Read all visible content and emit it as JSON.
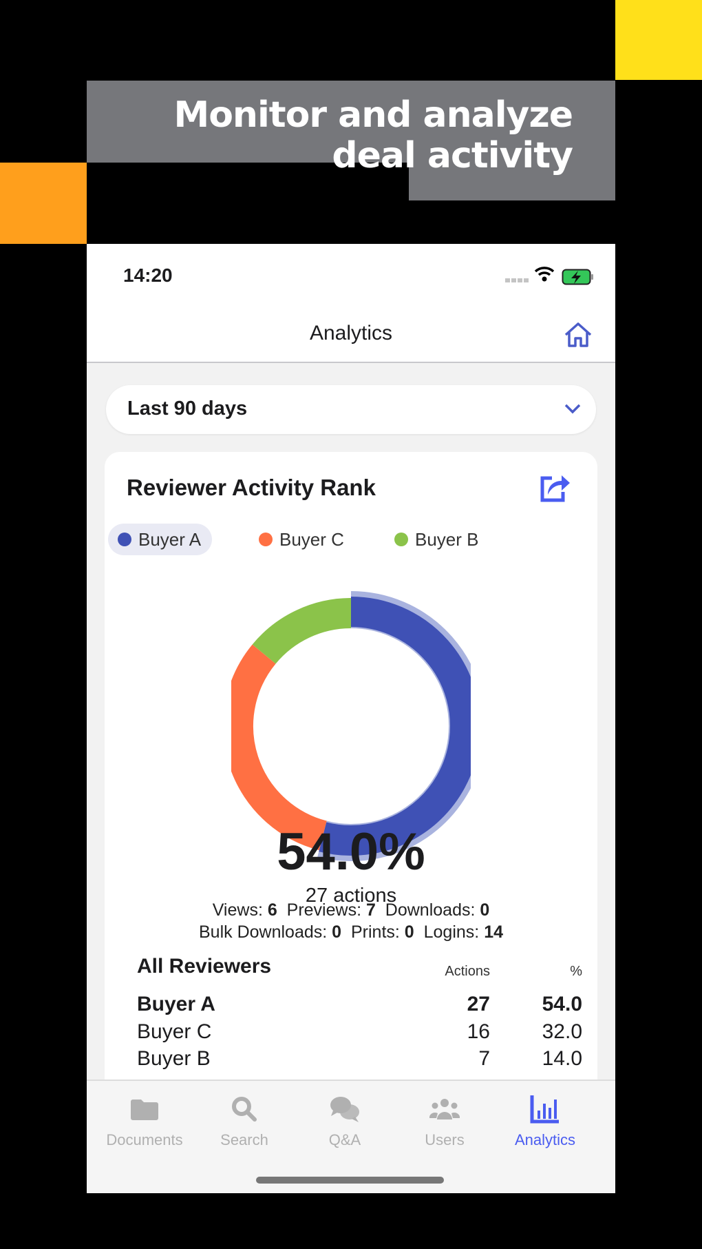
{
  "banner": {
    "headline": "Monitor and analyze deal activity"
  },
  "status_bar": {
    "time": "14:20"
  },
  "nav": {
    "title": "Analytics",
    "home_icon": "home-icon"
  },
  "filter": {
    "selected": "Last 90 days"
  },
  "card": {
    "title": "Reviewer Activity Rank",
    "share_icon": "share-icon"
  },
  "colors": {
    "Buyer A": "#3f51b5",
    "Buyer C": "#ff7043",
    "Buyer B": "#8bc34a",
    "highlight": "#a9b3df",
    "accent": "#4a5cf0"
  },
  "chart_data": {
    "type": "pie",
    "legend": [
      "Buyer A",
      "Buyer C",
      "Buyer B"
    ],
    "legend_selected": "Buyer A",
    "categories": [
      "Buyer A",
      "Buyer C",
      "Buyer B"
    ],
    "values": [
      27,
      16,
      7
    ],
    "percent": [
      54.0,
      32.0,
      14.0
    ],
    "center_value": "54.0%",
    "center_label": "27 actions"
  },
  "stats": {
    "line1": [
      {
        "label": "Views:",
        "value": "6"
      },
      {
        "label": "Previews:",
        "value": "7"
      },
      {
        "label": "Downloads:",
        "value": "0"
      }
    ],
    "line2": [
      {
        "label": "Bulk Downloads:",
        "value": "0"
      },
      {
        "label": "Prints:",
        "value": "0"
      },
      {
        "label": "Logins:",
        "value": "14"
      }
    ]
  },
  "table": {
    "title": "All Reviewers",
    "headers": {
      "actions": "Actions",
      "percent": "%"
    },
    "rows": [
      {
        "name": "Buyer A",
        "actions": "27",
        "percent": "54.0"
      },
      {
        "name": "Buyer C",
        "actions": "16",
        "percent": "32.0"
      },
      {
        "name": "Buyer B",
        "actions": "7",
        "percent": "14.0"
      }
    ]
  },
  "tabs": [
    {
      "label": "Documents",
      "icon": "folder-icon"
    },
    {
      "label": "Search",
      "icon": "search-icon"
    },
    {
      "label": "Q&A",
      "icon": "chat-icon"
    },
    {
      "label": "Users",
      "icon": "users-icon"
    },
    {
      "label": "Analytics",
      "icon": "bar-chart-icon",
      "active": true
    }
  ]
}
